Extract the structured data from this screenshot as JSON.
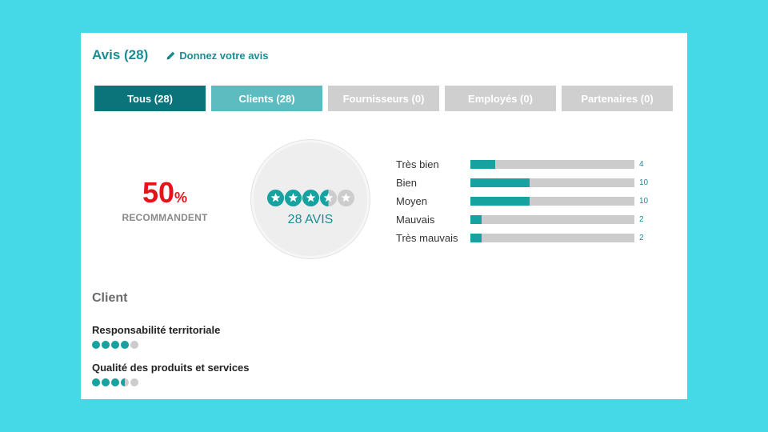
{
  "header": {
    "title": "Avis (28)",
    "write_review": "Donnez votre avis"
  },
  "tabs": [
    {
      "label": "Tous (28)",
      "state": "active"
    },
    {
      "label": "Clients (28)",
      "state": "secondary"
    },
    {
      "label": "Fournisseurs (0)",
      "state": "inactive"
    },
    {
      "label": "Employés (0)",
      "state": "inactive"
    },
    {
      "label": "Partenaires (0)",
      "state": "inactive"
    }
  ],
  "recommend": {
    "value": "50",
    "unit": "%",
    "label": "RECOMMANDENT"
  },
  "rating": {
    "stars": 3.5,
    "out_of": 5,
    "count_label": "28 AVIS"
  },
  "distribution": [
    {
      "label": "Très bien",
      "count": "4",
      "fraction": 0.15
    },
    {
      "label": "Bien",
      "count": "10",
      "fraction": 0.36
    },
    {
      "label": "Moyen",
      "count": "10",
      "fraction": 0.36
    },
    {
      "label": "Mauvais",
      "count": "2",
      "fraction": 0.07
    },
    {
      "label": "Très mauvais",
      "count": "2",
      "fraction": 0.07
    }
  ],
  "section": {
    "title": "Client"
  },
  "criteria": [
    {
      "label": "Responsabilité territoriale",
      "score": 4,
      "out_of": 5
    },
    {
      "label": "Qualité des produits et services",
      "score": 3.5,
      "out_of": 5
    }
  ],
  "colors": {
    "background": "#45d8e6",
    "accent": "#1a8d93",
    "tab_active": "#0b737a",
    "tab_secondary": "#5cbcc0",
    "tab_inactive": "#cfcfcf",
    "recommend": "#e8121b",
    "bar_fill": "#16a2a0",
    "bar_track": "#cccccc",
    "dot_empty": "#cccccc"
  },
  "icons": {
    "write_review": "pencil-icon",
    "rating": "star-icon",
    "criteria": "dot-icon"
  }
}
